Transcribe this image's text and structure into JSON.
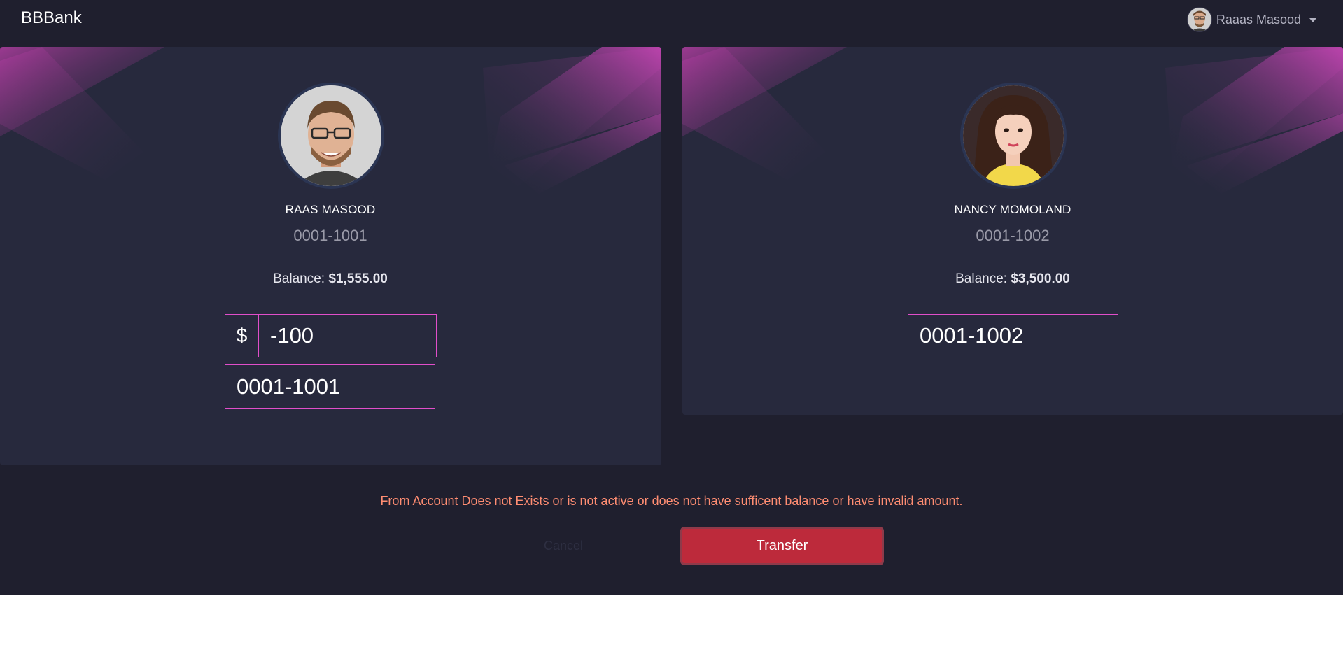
{
  "navbar": {
    "brand": "BBBank",
    "user_name": "Raaas Masood"
  },
  "from_account": {
    "name": "RAAS MASOOD",
    "account_number": "0001-1001",
    "balance_label": "Balance: ",
    "balance_value": "$1,555.00",
    "currency_symbol": "$",
    "amount_value": "-100",
    "account_input_value": "0001-1001"
  },
  "to_account": {
    "name": "NANCY MOMOLAND",
    "account_number": "0001-1002",
    "balance_label": "Balance: ",
    "balance_value": "$3,500.00",
    "account_input_value": "0001-1002"
  },
  "error_message": "From Account Does not Exists or is not active or does not have sufficent balance or have invalid amount.",
  "actions": {
    "cancel_label": "Cancel",
    "transfer_label": "Transfer"
  },
  "colors": {
    "background": "#1f1f2e",
    "card": "#27293d",
    "accent": "#e14eca",
    "danger": "#bd2a3b",
    "error_text": "#ff8d72"
  }
}
